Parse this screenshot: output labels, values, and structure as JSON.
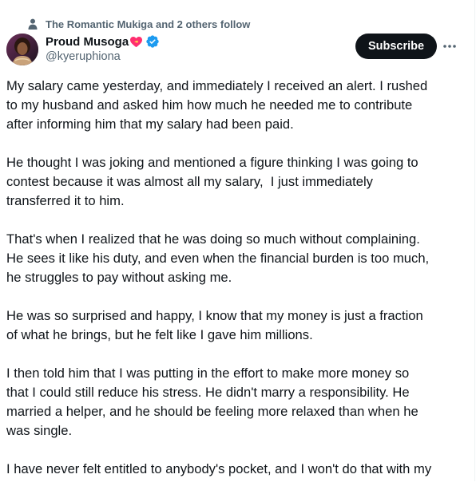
{
  "social_context": {
    "text": "The Romantic Mukiga and 2 others follow",
    "icon": "person-icon"
  },
  "author": {
    "name": "Proud Musoga",
    "name_emoji": "heart-with-ribbon-icon",
    "verified": true,
    "verified_color": "#1d9bf0",
    "handle": "@kyeruphiona"
  },
  "actions": {
    "subscribe_label": "Subscribe",
    "more_icon": "more-horizontal-icon"
  },
  "tweet": {
    "paragraphs": [
      {
        "lines": [
          "My salary came yesterday, and immediately I received an alert. I rushed",
          "to my husband and asked him how much he needed me to contribute",
          "after informing him that my salary had been paid."
        ]
      },
      {
        "lines": [
          "He thought I was joking and mentioned a figure thinking I was going to",
          "contest because it was almost all my salary,  I just immediately",
          "transferred it to him."
        ]
      },
      {
        "lines": [
          "That's when I realized that he was doing so much without complaining.",
          "He sees it like his duty, and even when the financial burden is too much,",
          "he struggles to pay without asking me."
        ]
      },
      {
        "lines": [
          "He was so surprised and happy, I know that my money is just a fraction",
          "of what he brings, but he felt like I gave him millions."
        ]
      },
      {
        "lines": [
          "I then told him that I was putting in the effort to make more money so",
          "that I could still reduce his stress. He didn't marry a responsibility. He",
          "married a helper, and he should be feeling more relaxed than when he",
          "was single."
        ]
      },
      {
        "lines": [
          "I have never felt entitled to anybody's pocket, and I won't do that with my"
        ]
      }
    ]
  }
}
